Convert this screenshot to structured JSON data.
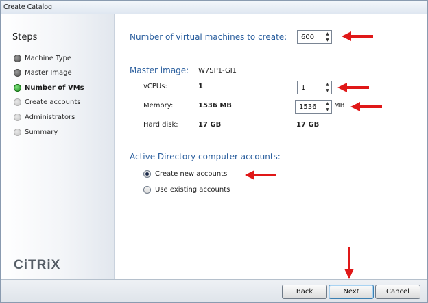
{
  "window": {
    "title": "Create Catalog"
  },
  "sidebar": {
    "title": "Steps",
    "steps": [
      {
        "label": "Machine Type",
        "state": "done"
      },
      {
        "label": "Master Image",
        "state": "done"
      },
      {
        "label": "Number of VMs",
        "state": "active"
      },
      {
        "label": "Create accounts",
        "state": "todo"
      },
      {
        "label": "Administrators",
        "state": "todo"
      },
      {
        "label": "Summary",
        "state": "todo"
      }
    ],
    "logo": "CiTRiX"
  },
  "main": {
    "vm_count": {
      "label": "Number of virtual machines to create:",
      "value": "600"
    },
    "master_image": {
      "label": "Master image:",
      "name": "W7SP1-GI1",
      "vcpus": {
        "label": "vCPUs:",
        "value": "1",
        "input_value": "1"
      },
      "memory": {
        "label": "Memory:",
        "value": "1536 MB",
        "input_value": "1536",
        "unit": "MB"
      },
      "hard_disk": {
        "label": "Hard disk:",
        "value": "17 GB",
        "value2": "17 GB"
      }
    },
    "ad": {
      "heading": "Active Directory computer accounts:",
      "options": [
        {
          "label": "Create new accounts",
          "checked": true
        },
        {
          "label": "Use existing accounts",
          "checked": false
        }
      ]
    }
  },
  "footer": {
    "back": "Back",
    "next": "Next",
    "cancel": "Cancel"
  },
  "colors": {
    "heading": "#2b5f9e",
    "annotation_arrow": "#e01818",
    "active_step": "#1d8a1d"
  },
  "icons": {
    "spin": "spin-arrows-icon",
    "annotation": "red-arrow-icon"
  }
}
